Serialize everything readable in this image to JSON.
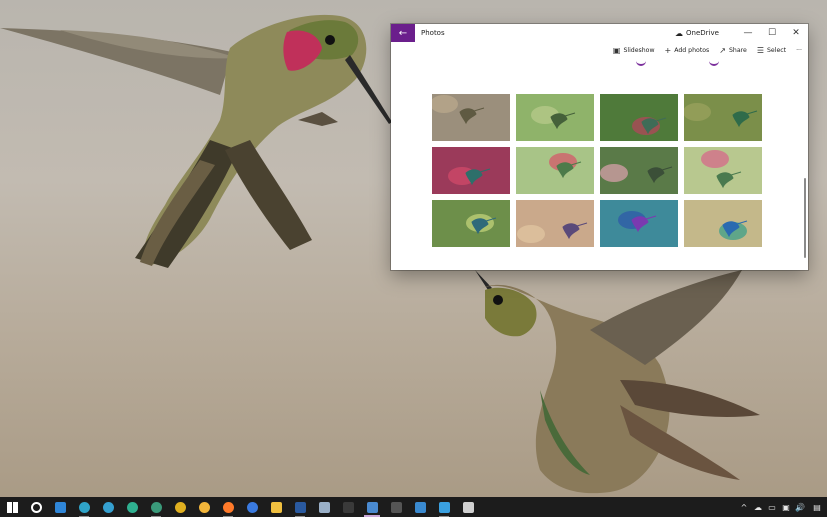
{
  "window": {
    "title": "Photos",
    "back_label": "←",
    "sync_label": "OneDrive",
    "controls": {
      "minimize": "—",
      "maximize": "☐",
      "close": "✕"
    }
  },
  "commandbar": {
    "slideshow": "Slideshow",
    "add_photos": "Add photos",
    "share": "Share",
    "select": "Select",
    "more": "···"
  },
  "photos": [
    {
      "bg": "#9b8f7c",
      "accent": "#b9a88c",
      "bird": "#5f5a42"
    },
    {
      "bg": "#8fb36a",
      "accent": "#b7c98b",
      "bird": "#45613a"
    },
    {
      "bg": "#4f7a3a",
      "accent": "#b2475b",
      "bird": "#3f6c57"
    },
    {
      "bg": "#7b8f4a",
      "accent": "#9aa25d",
      "bird": "#2f6b4a"
    },
    {
      "bg": "#9b3a5a",
      "accent": "#d04a6a",
      "bird": "#2d6f6a"
    },
    {
      "bg": "#a8c487",
      "accent": "#d45a6a",
      "bird": "#4c7b4a"
    },
    {
      "bg": "#5a7a48",
      "accent": "#d6a0a8",
      "bird": "#3b4f38"
    },
    {
      "bg": "#b8c88f",
      "accent": "#d66a8a",
      "bird": "#4a7a4f"
    },
    {
      "bg": "#6d8f4a",
      "accent": "#c1d27a",
      "bird": "#2f6a7a"
    },
    {
      "bg": "#caa98b",
      "accent": "#e0c5a0",
      "bird": "#5a4a7a"
    },
    {
      "bg": "#3e8a9a",
      "accent": "#2f5aa8",
      "bird": "#7a3ab0"
    },
    {
      "bg": "#c4b88a",
      "accent": "#3ea088",
      "bird": "#2a6ab0"
    }
  ],
  "colors": {
    "accent": "#6b1f8c",
    "taskbar": "#1c1c1c"
  },
  "taskbar": {
    "items": [
      {
        "name": "start-icon",
        "color": "#ffffff"
      },
      {
        "name": "settings-icon",
        "color": "#ffffff"
      },
      {
        "name": "phone-icon",
        "color": "#2f86d8"
      },
      {
        "name": "edge-icon",
        "color": "#2fa3c8"
      },
      {
        "name": "edge-beta-icon",
        "color": "#35a0d0"
      },
      {
        "name": "edge-dev-icon",
        "color": "#2fb090"
      },
      {
        "name": "edge-canary-icon",
        "color": "#3a9a7a"
      },
      {
        "name": "chrome-icon",
        "color": "#e0b020"
      },
      {
        "name": "chrome-canary-icon",
        "color": "#f2b53a"
      },
      {
        "name": "firefox-icon",
        "color": "#ff7a2a"
      },
      {
        "name": "firefox-dev-icon",
        "color": "#3a7ae0"
      },
      {
        "name": "file-explorer-icon",
        "color": "#f0c040"
      },
      {
        "name": "powershell-icon",
        "color": "#2a5aa0"
      },
      {
        "name": "notepad-icon",
        "color": "#9ab0c8"
      },
      {
        "name": "terminal-icon",
        "color": "#3a3a3a"
      },
      {
        "name": "photos-icon",
        "color": "#4a8ad0"
      },
      {
        "name": "cmd-icon",
        "color": "#555555"
      },
      {
        "name": "onedrive-app-icon",
        "color": "#3a8ad0"
      },
      {
        "name": "remote-desktop-icon",
        "color": "#3aa0e0"
      },
      {
        "name": "store-icon",
        "color": "#d0d0d0"
      }
    ],
    "tray": [
      "^",
      "☁",
      "▭",
      "▣",
      "🔊",
      "▤"
    ]
  }
}
